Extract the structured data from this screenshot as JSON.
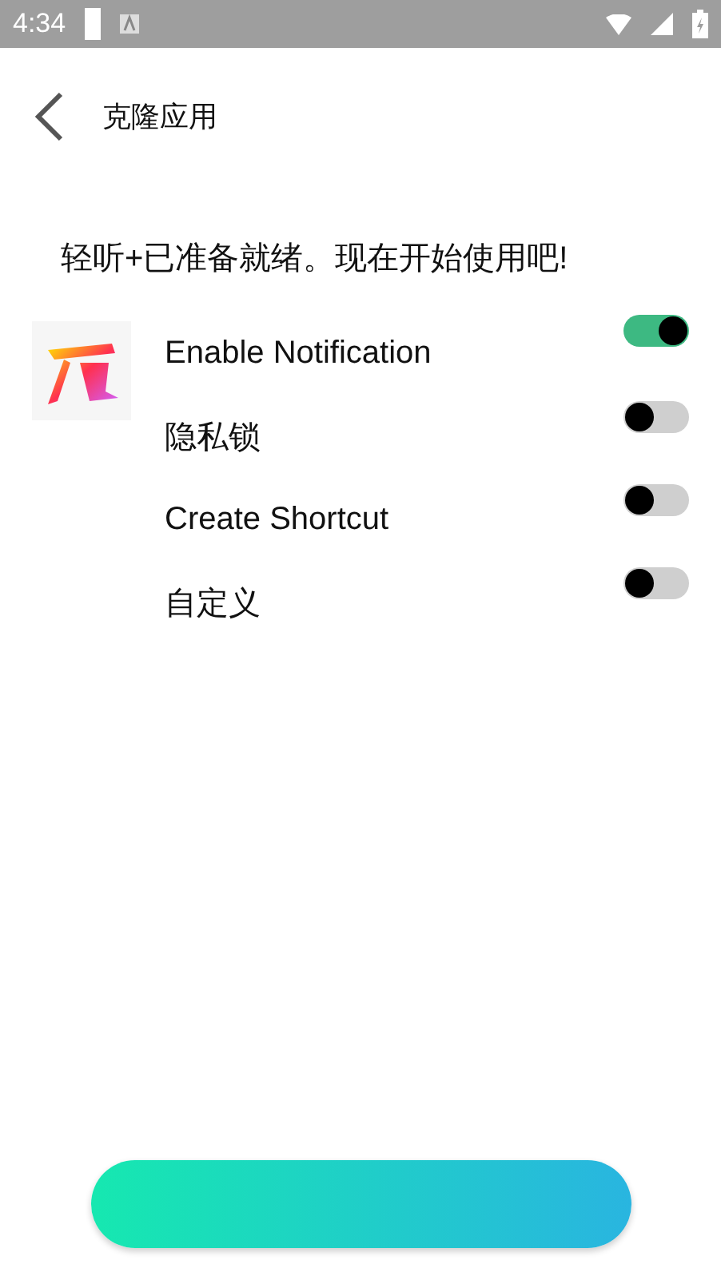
{
  "status_bar": {
    "time": "4:34"
  },
  "header": {
    "title": "克隆应用"
  },
  "message": "轻听+已准备就绪。现在开始使用吧!",
  "settings": [
    {
      "label": "Enable Notification",
      "on": true
    },
    {
      "label": "隐私锁",
      "on": false
    },
    {
      "label": "Create Shortcut",
      "on": false
    },
    {
      "label": "自定义",
      "on": false
    }
  ]
}
